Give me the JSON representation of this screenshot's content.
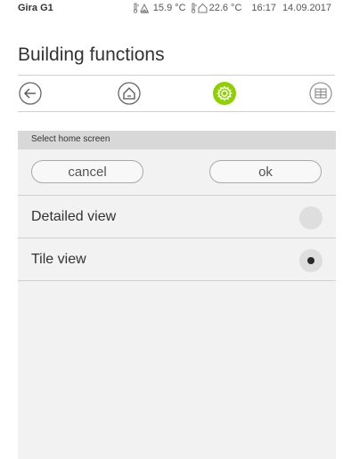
{
  "status_bar": {
    "device_name": "Gira G1",
    "outdoor_temp": "15.9 °C",
    "indoor_temp": "22.6 °C",
    "time": "16:17",
    "date": "14.09.2017",
    "outdoor_icon": "outdoor-thermometer-icon",
    "indoor_icon": "indoor-thermometer-icon"
  },
  "header": {
    "title": "Building functions"
  },
  "nav": {
    "items": [
      {
        "name": "back",
        "icon": "arrow-left-icon",
        "active": false
      },
      {
        "name": "home",
        "icon": "home-icon",
        "active": false
      },
      {
        "name": "settings",
        "icon": "gear-icon",
        "active": true
      },
      {
        "name": "tiles",
        "icon": "grid-icon",
        "active": false
      }
    ],
    "accent_color": "#8fd100"
  },
  "panel": {
    "header": "Select home screen",
    "cancel_label": "cancel",
    "ok_label": "ok",
    "options": [
      {
        "label": "Detailed view",
        "selected": false
      },
      {
        "label": "Tile view",
        "selected": true
      }
    ]
  }
}
